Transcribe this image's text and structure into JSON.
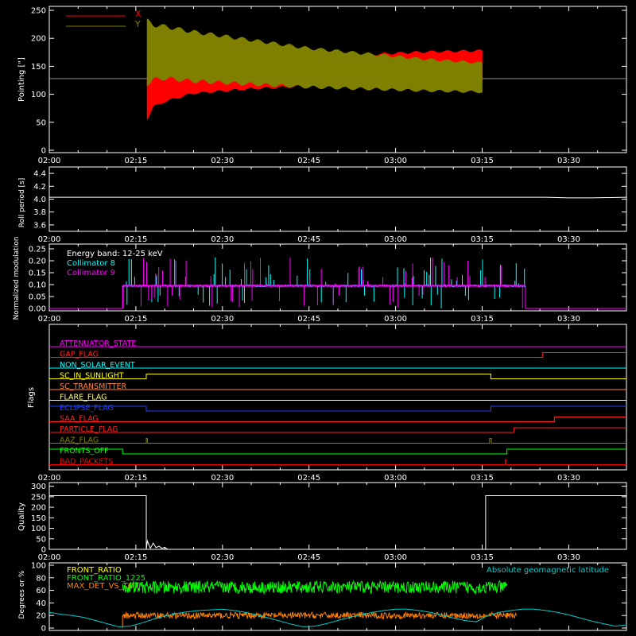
{
  "colors": {
    "background": "#000000",
    "axis": "#ffffff",
    "x_series": "#ff0000",
    "y_series": "#808000",
    "collimator8": "#00ffff",
    "collimator9": "#ff00ff",
    "front_ratio": "#ffff00",
    "front_ratio_1225": "#00ff00",
    "max_det": "#ff8000",
    "geomag": "#00cccc"
  },
  "time_axis": {
    "range_minutes_after_0200": [
      0,
      100
    ],
    "tick_labels": [
      "02:00",
      "02:15",
      "02:30",
      "02:45",
      "03:00",
      "03:15",
      "03:30"
    ],
    "tick_minutes": [
      0,
      15,
      30,
      45,
      60,
      75,
      90
    ]
  },
  "chart_data": [
    {
      "type": "area",
      "ylabel": "Pointing [\"]",
      "ylim": [
        0,
        250
      ],
      "yticks": [
        "0",
        "50",
        "100",
        "150",
        "200",
        "250"
      ],
      "ytick_values": [
        0,
        50,
        100,
        150,
        200,
        250
      ],
      "legend_placement": "top-left",
      "reference_line": 128,
      "series": [
        {
          "name": "X",
          "x": [
            17,
            18,
            20,
            25,
            35,
            45,
            55,
            65,
            75
          ],
          "lower": [
            55,
            75,
            85,
            100,
            108,
            113,
            117,
            120,
            123
          ],
          "upper": [
            130,
            135,
            138,
            150,
            160,
            168,
            173,
            178,
            180
          ]
        },
        {
          "name": "Y",
          "x": [
            17,
            18,
            20,
            25,
            35,
            45,
            55,
            65,
            75
          ],
          "lower": [
            115,
            122,
            125,
            120,
            115,
            110,
            107,
            104,
            102
          ],
          "upper": [
            235,
            228,
            225,
            215,
            200,
            185,
            175,
            165,
            158
          ]
        }
      ]
    },
    {
      "type": "line",
      "ylabel": "Roll period [s]",
      "ylim": [
        3.5,
        4.5
      ],
      "yticks": [
        "3.6",
        "3.8",
        "4.0",
        "4.2",
        "4.4"
      ],
      "ytick_values": [
        3.6,
        3.8,
        4.0,
        4.2,
        4.4
      ],
      "series": [
        {
          "x": [
            0,
            30,
            60,
            86,
            90,
            94,
            100
          ],
          "y": [
            4.03,
            4.03,
            4.03,
            4.03,
            4.02,
            4.02,
            4.03
          ]
        }
      ]
    },
    {
      "type": "line",
      "ylabel": "Normalized modulation",
      "ylim": [
        0,
        0.26
      ],
      "yticks": [
        "0.00",
        "0.05",
        "0.10",
        "0.15",
        "0.20",
        "0.25"
      ],
      "ytick_values": [
        0.0,
        0.05,
        0.1,
        0.15,
        0.2,
        0.25
      ],
      "annotation": "Energy band: 12-25 keV",
      "legend_placement": "top-left",
      "x_range": [
        12.7,
        82.5
      ],
      "baseline": 0.095,
      "series": [
        {
          "name": "Collimator 8"
        },
        {
          "name": "Collimator 9"
        }
      ]
    },
    {
      "type": "line",
      "ylabel": "Flags",
      "flags": [
        {
          "name": "ATTENUATOR_STATE",
          "color": "#ff00ff",
          "steps": [
            [
              0,
              0
            ],
            [
              100,
              0
            ]
          ]
        },
        {
          "name": "GAP_FLAG",
          "color": "#ff2020",
          "steps": [
            [
              0,
              0
            ],
            [
              85.5,
              1
            ],
            [
              100,
              1
            ]
          ]
        },
        {
          "name": "NON_SOLAR_EVENT",
          "color": "#00ffff",
          "steps": [
            [
              0,
              0
            ],
            [
              100,
              0
            ]
          ]
        },
        {
          "name": "SC_IN_SUNLIGHT",
          "color": "#ffff00",
          "steps": [
            [
              0,
              0
            ],
            [
              16.8,
              1
            ],
            [
              76.5,
              0
            ],
            [
              100,
              0
            ]
          ]
        },
        {
          "name": "SC_TRANSMITTER",
          "color": "#ff8040",
          "steps": [
            [
              0,
              0
            ],
            [
              100,
              0
            ]
          ]
        },
        {
          "name": "FLARE_FLAG",
          "color": "#ffff80",
          "steps": [
            [
              0,
              0
            ],
            [
              100,
              0
            ]
          ]
        },
        {
          "name": "ECLIPSE_FLAG",
          "color": "#2040ff",
          "steps": [
            [
              0,
              1
            ],
            [
              16.8,
              0
            ],
            [
              76.5,
              1
            ],
            [
              100,
              1
            ]
          ]
        },
        {
          "name": "SAA_FLAG",
          "color": "#ff2020",
          "steps": [
            [
              0,
              0
            ],
            [
              87.5,
              1
            ],
            [
              100,
              1
            ]
          ]
        },
        {
          "name": "PARTICLE_FLAG",
          "color": "#ff2020",
          "steps": [
            [
              0,
              0
            ],
            [
              80.5,
              1
            ],
            [
              100,
              1
            ]
          ]
        },
        {
          "name": "AAZ_FLAG",
          "color": "#808000",
          "steps": [
            [
              0,
              0
            ],
            [
              16.8,
              1
            ],
            [
              17.0,
              0
            ],
            [
              76.3,
              1
            ],
            [
              76.6,
              0
            ],
            [
              100,
              0
            ]
          ]
        },
        {
          "name": "FRONTS_OFF",
          "color": "#00ff00",
          "steps": [
            [
              0,
              1
            ],
            [
              12.7,
              0
            ],
            [
              79.3,
              1
            ],
            [
              100,
              1
            ]
          ]
        },
        {
          "name": "BAD_PACKETS",
          "color": "#ff0000",
          "steps": [
            [
              0,
              0
            ],
            [
              79.0,
              1
            ],
            [
              79.2,
              0
            ],
            [
              100,
              0
            ]
          ]
        }
      ]
    },
    {
      "type": "line",
      "ylabel": "Quality",
      "ylim": [
        0,
        310
      ],
      "yticks": [
        "0",
        "50",
        "100",
        "150",
        "200",
        "250",
        "300"
      ],
      "ytick_values": [
        0,
        50,
        100,
        150,
        200,
        250,
        300
      ],
      "series": [
        {
          "x": [
            0,
            16.8,
            16.8,
            17.0,
            17.5,
            18.0,
            18.5,
            19.0,
            19.5,
            20.0,
            20.5,
            21.0,
            75.6,
            75.6,
            100
          ],
          "y": [
            255,
            255,
            0,
            40,
            5,
            30,
            8,
            15,
            5,
            10,
            0,
            0,
            0,
            255,
            255
          ]
        }
      ]
    },
    {
      "type": "line",
      "ylabel": "Degrees or %",
      "ylim": [
        0,
        100
      ],
      "yticks": [
        "0",
        "20",
        "40",
        "60",
        "80",
        "100"
      ],
      "ytick_values": [
        0,
        20,
        40,
        60,
        80,
        100
      ],
      "legend_placement": "top-left",
      "right_legend": "Absolute geomagnetic latitude",
      "series": [
        {
          "name": "FRONT_RATIO",
          "x_range": [
            12.7,
            79.3
          ],
          "mean": 65,
          "spread": 10
        },
        {
          "name": "FRONT_RATIO_1225",
          "x_range": [
            12.7,
            79.3
          ],
          "mean": 65,
          "spread": 10
        },
        {
          "name": "MAX_DET_VS_TOT",
          "x_range": [
            12.7,
            81.0
          ],
          "mean": 20,
          "spread": 5
        },
        {
          "name": "Absolute geomagnetic latitude",
          "x": [
            0,
            2,
            4,
            6,
            8,
            10,
            12,
            14,
            16,
            18,
            20,
            22,
            24,
            26,
            28,
            30,
            32,
            34,
            36,
            38,
            40,
            42,
            44,
            46,
            48,
            50,
            52,
            54,
            56,
            58,
            60,
            62,
            64,
            66,
            68,
            70,
            72,
            74,
            76,
            78,
            80,
            82,
            84,
            86,
            88,
            90,
            92,
            94,
            96,
            98,
            100
          ],
          "y": [
            25,
            22,
            20,
            17,
            12,
            7,
            2,
            3,
            8,
            14,
            19,
            23,
            26,
            28,
            29,
            30,
            28,
            25,
            21,
            16,
            11,
            6,
            2,
            3,
            7,
            12,
            17,
            21,
            25,
            28,
            30,
            30,
            28,
            25,
            21,
            16,
            12,
            10,
            20,
            25,
            28,
            30,
            30,
            28,
            25,
            21,
            16,
            11,
            7,
            3,
            5
          ]
        }
      ]
    }
  ]
}
